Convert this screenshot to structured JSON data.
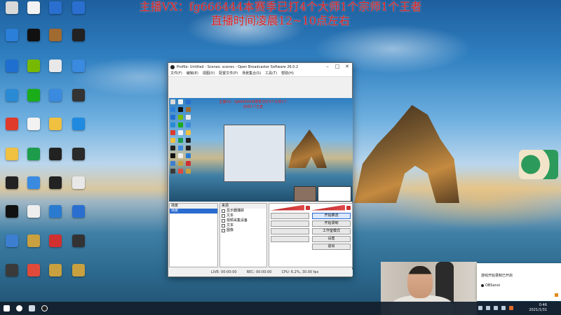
{
  "banner": {
    "line1": "主播VX：fg666444本赛季已打4个大师1个宗师1个王者",
    "line2": "直播时间凌晨12~10点左右"
  },
  "desktop_icons": [
    {
      "label": "",
      "color": "#d9d9d9"
    },
    {
      "label": "",
      "color": "#2b7fd8"
    },
    {
      "label": "",
      "color": "#1f6fd0"
    },
    {
      "label": "",
      "color": "#2a8ad4"
    },
    {
      "label": "",
      "color": "#e03a2a"
    },
    {
      "label": "",
      "color": "#f0c040"
    },
    {
      "label": "",
      "color": "#222222"
    },
    {
      "label": "",
      "color": "#111111"
    },
    {
      "label": "",
      "color": "#3c7fd0"
    },
    {
      "label": "",
      "color": "#3a3a3a"
    },
    {
      "label": "",
      "color": "#f2f2f2"
    },
    {
      "label": "",
      "color": "#111111"
    },
    {
      "label": "",
      "color": "#76b900"
    },
    {
      "label": "",
      "color": "#1aad19"
    },
    {
      "label": "",
      "color": "#f2f2f2"
    },
    {
      "label": "",
      "color": "#1d9c4c"
    },
    {
      "label": "",
      "color": "#3a8ae0"
    },
    {
      "label": "",
      "color": "#eeeeee"
    },
    {
      "label": "",
      "color": "#c8a040"
    },
    {
      "label": "",
      "color": "#e04a3a"
    },
    {
      "label": "",
      "color": "#2a6fd0"
    },
    {
      "label": "",
      "color": "#a06a30"
    },
    {
      "label": "",
      "color": "#e8e8e8"
    },
    {
      "label": "",
      "color": "#3a8ae0"
    },
    {
      "label": "",
      "color": "#f0c040"
    },
    {
      "label": "",
      "color": "#222222"
    },
    {
      "label": "",
      "color": "#222222"
    },
    {
      "label": "",
      "color": "#2a7ad0"
    },
    {
      "label": "",
      "color": "#d03030"
    },
    {
      "label": "",
      "color": "#c8a040"
    },
    {
      "label": "",
      "color": "#2a6fd0"
    },
    {
      "label": "",
      "color": "#222222"
    },
    {
      "label": "",
      "color": "#3a8ae0"
    },
    {
      "label": "",
      "color": "#333333"
    },
    {
      "label": "",
      "color": "#1f8ae0"
    },
    {
      "label": "",
      "color": "#2a2a2a"
    },
    {
      "label": "",
      "color": "#e8e8e8"
    },
    {
      "label": "",
      "color": "#2a6fd0"
    },
    {
      "label": "",
      "color": "#333333"
    },
    {
      "label": "",
      "color": "#c8a040"
    }
  ],
  "obs": {
    "title": "Profile: Untitled - Scenes: scenes - Open Broadcaster Software 26.0.2",
    "menu": [
      "文件(F)",
      "编辑(E)",
      "视图(V)",
      "配置文件(P)",
      "场景集合(S)",
      "工具(T)",
      "帮助(H)"
    ],
    "scenes_title": "场景",
    "scene_selected": "场景",
    "sources_title": "来源",
    "sources": [
      "显示器捕获",
      "文本",
      "视频采集设备",
      "文本",
      "图像"
    ],
    "controls": [
      "开始推流",
      "开始录制",
      "工作室模式",
      "设置",
      "退出"
    ],
    "status": [
      "LIVE: 00:00:00",
      "REC: 00:00:00",
      "CPU: 6.2%, 30.00 fps"
    ]
  },
  "toast": {
    "line1": "游戏开始录制已开启",
    "line2": "OBSanoi"
  },
  "tray": {
    "time": "0:46",
    "date": "2021/1/31"
  }
}
